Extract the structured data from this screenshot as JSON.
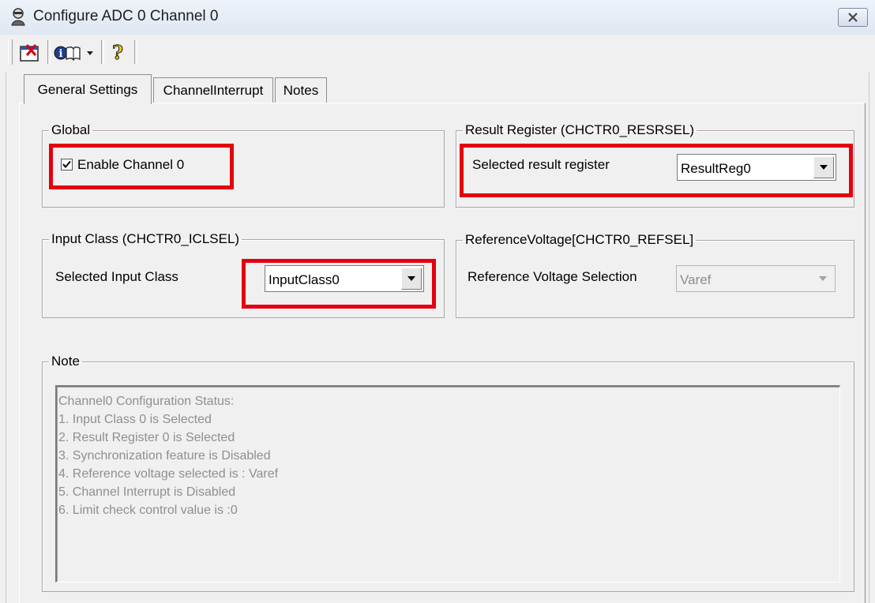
{
  "window": {
    "title": "Configure ADC 0 Channel 0"
  },
  "toolbar": {
    "items": [
      {
        "name": "close-config-icon"
      },
      {
        "name": "info-book-icon"
      },
      {
        "name": "dropdown-arrow-icon"
      },
      {
        "name": "help-icon"
      }
    ]
  },
  "tabs": [
    {
      "label": "General Settings",
      "active": true
    },
    {
      "label": "ChannelInterrupt",
      "active": false
    },
    {
      "label": "Notes",
      "active": false
    }
  ],
  "global": {
    "legend": "Global",
    "enable_channel_label": "Enable Channel 0",
    "enable_channel_checked": true
  },
  "result_register": {
    "legend": "Result Register (CHCTR0_RESRSEL)",
    "label": "Selected result register",
    "value": "ResultReg0"
  },
  "input_class": {
    "legend": "Input Class (CHCTR0_ICLSEL)",
    "label": "Selected Input Class",
    "value": "InputClass0"
  },
  "reference_voltage": {
    "legend": "ReferenceVoltage[CHCTR0_REFSEL]",
    "label": "Reference Voltage Selection",
    "value": "Varef",
    "enabled": false
  },
  "note": {
    "legend": "Note",
    "lines": [
      "Channel0 Configuration Status:",
      "1. Input Class 0 is Selected",
      "2. Result Register 0 is Selected",
      "3. Synchronization feature is Disabled",
      "4. Reference voltage selected is : Varef",
      "5. Channel Interrupt is Disabled",
      "6. Limit check control value is :0"
    ]
  },
  "colors": {
    "highlight": "#e3000f",
    "background": "#f0f0f0",
    "disabled_text": "#8f8f8f"
  }
}
